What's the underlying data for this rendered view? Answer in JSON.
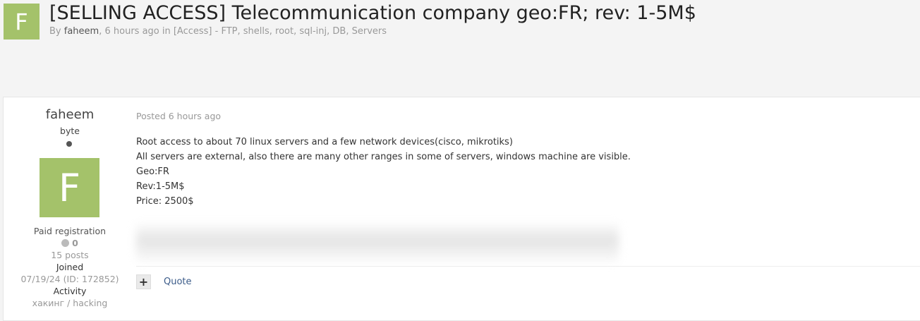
{
  "topic": {
    "avatar_letter": "F",
    "title": "[SELLING ACCESS] Telecommunication company geo:FR; rev: 1-5M$",
    "byline_prefix": "By",
    "author": "faheem",
    "byline_suffix": ", 6 hours ago in [Access] - FTP, shells, root, sql-inj, DB, Servers"
  },
  "post": {
    "author": {
      "name": "faheem",
      "rank": "byte",
      "avatar_letter": "F",
      "group": "Paid registration",
      "reputation": "0",
      "posts": "15 posts",
      "joined_label": "Joined",
      "joined_value": "07/19/24 (ID: 172852)",
      "activity_label": "Activity",
      "activity_value": "хакинг / hacking"
    },
    "posted": "Posted 6 hours ago",
    "body": [
      "Root access to about 70 linux servers and a few network devices(cisco, mikrotiks)",
      "All servers are external, also there are many other ranges in some of servers, windows machine are visible.",
      "Geo:FR",
      "Rev:1-5M$",
      "Price: 2500$"
    ],
    "actions": {
      "plus": "+",
      "quote": "Quote"
    }
  },
  "colors": {
    "avatar_bg": "#a4c26a",
    "link": "#3b5b89"
  }
}
